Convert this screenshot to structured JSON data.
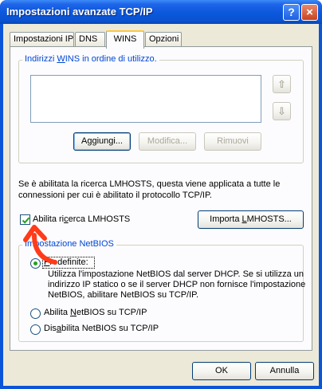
{
  "window": {
    "title": "Impostazioni avanzate TCP/IP",
    "help_glyph": "?",
    "close_glyph": "×"
  },
  "tabs": [
    {
      "label": "Impostazioni IP"
    },
    {
      "label": "DNS"
    },
    {
      "label": "WINS"
    },
    {
      "label": "Opzioni"
    }
  ],
  "wins_group": {
    "label_pre": "Indirizzi ",
    "label_key": "W",
    "label_post": "INS in ordine di utilizzo.",
    "up_glyph": "⇧",
    "down_glyph": "⇩",
    "add_label": "Aggiungi...",
    "modify_label": "Modifica...",
    "remove_label": "Rimuovi"
  },
  "lmhosts": {
    "description_line1": "Se è abilitata la ricerca LMHOSTS, questa viene applicata a tutte le",
    "description_line2": "connessioni per cui è abilitato il protocollo TCP/IP.",
    "checkbox_pre": "Abilita ri",
    "checkbox_key": "c",
    "checkbox_post": "erca LMHOSTS",
    "checked": true,
    "import_label_pre": "Importa ",
    "import_label_key": "L",
    "import_label_post": "MHOSTS..."
  },
  "netbios": {
    "group_label": "Impostazione NetBIOS",
    "options": [
      {
        "label_key": "P",
        "label_post": "redefinite:",
        "selected": true
      },
      {
        "label_pre": "Abilita ",
        "label_key": "N",
        "label_post": "etBIOS su TCP/IP",
        "selected": false
      },
      {
        "label_pre": "Dis",
        "label_key": "a",
        "label_post": "bilita NetBIOS su TCP/IP",
        "selected": false
      }
    ],
    "default_desc_line1": "Utilizza l'impostazione NetBIOS dal server DHCP. Se si utilizza un",
    "default_desc_line2": "indirizzo IP statico o se il server DHCP non fornisce l'impostazione",
    "default_desc_line3": "NetBIOS, abilitare NetBIOS su TCP/IP."
  },
  "footer": {
    "ok_label": "OK",
    "cancel_label": "Annulla"
  },
  "colors": {
    "titlebar": "#0a58dc",
    "accent_legend": "#0046d5",
    "annotation_arrow": "#ff3b1a"
  }
}
